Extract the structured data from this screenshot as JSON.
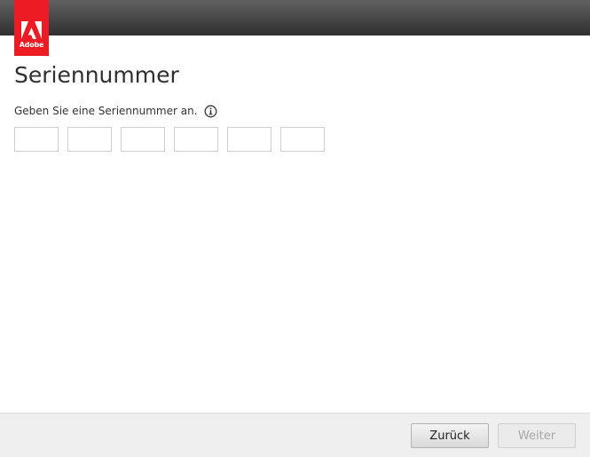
{
  "brand": {
    "logo_text": "Adobe",
    "color": "#ed1c24"
  },
  "page": {
    "title": "Seriennummer",
    "prompt": "Geben Sie eine Seriennummer an.",
    "info_icon": "info-icon"
  },
  "serial": {
    "fields": [
      "",
      "",
      "",
      "",
      "",
      ""
    ]
  },
  "footer": {
    "back_label": "Zurück",
    "next_label": "Weiter",
    "next_enabled": false
  }
}
